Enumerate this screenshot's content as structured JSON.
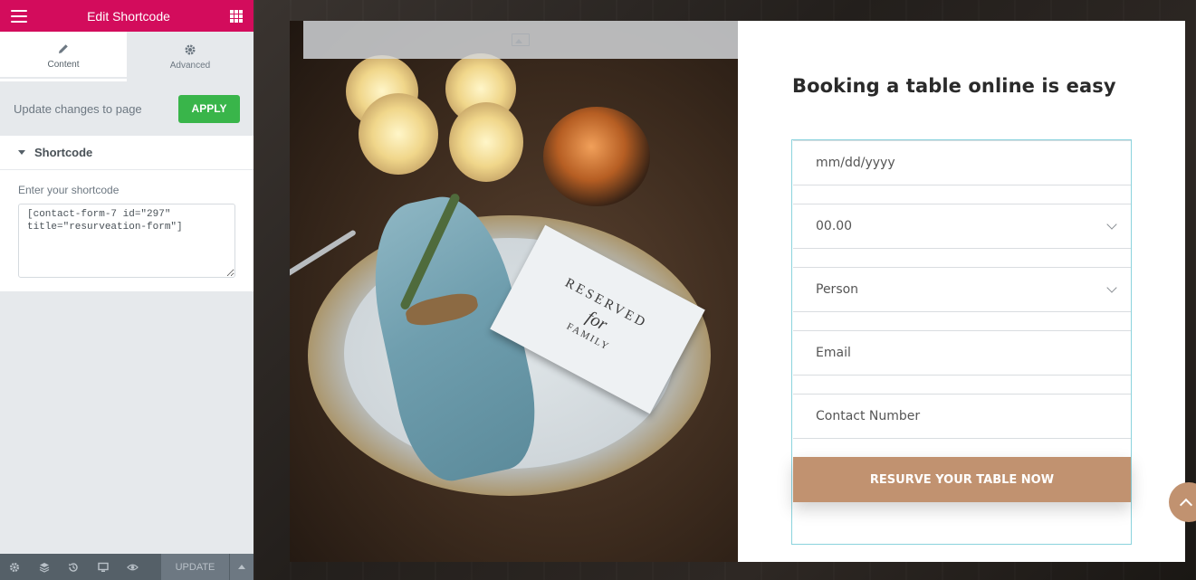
{
  "editor": {
    "header_title": "Edit Shortcode",
    "tabs": [
      {
        "label": "Content",
        "icon": "pencil-icon"
      },
      {
        "label": "Advanced",
        "icon": "gear-icon"
      }
    ],
    "apply_row": {
      "text": "Update changes to page",
      "button": "APPLY"
    },
    "section": {
      "title": "Shortcode",
      "field_label": "Enter your shortcode",
      "value": "[contact-form-7 id=\"297\" title=\"resurveation-form\"]"
    },
    "footer": {
      "update_label": "UPDATE",
      "icons": [
        "settings-icon",
        "layers-icon",
        "history-icon",
        "responsive-icon",
        "preview-eye-icon"
      ]
    }
  },
  "preview": {
    "card": {
      "line1": "RESERVED",
      "line2": "for",
      "line3": "FAMILY"
    },
    "booking": {
      "title": "Booking a table online is easy",
      "fields": {
        "date": "mm/dd/yyyy",
        "time": "00.00",
        "person": "Person",
        "email": "Email",
        "contact": "Contact Number"
      },
      "submit": "RESURVE YOUR TABLE NOW"
    }
  },
  "colors": {
    "editor_accent": "#d30c5c",
    "apply_green": "#39b54a",
    "button_brown": "#c19270",
    "form_border": "#8bd3dd"
  }
}
